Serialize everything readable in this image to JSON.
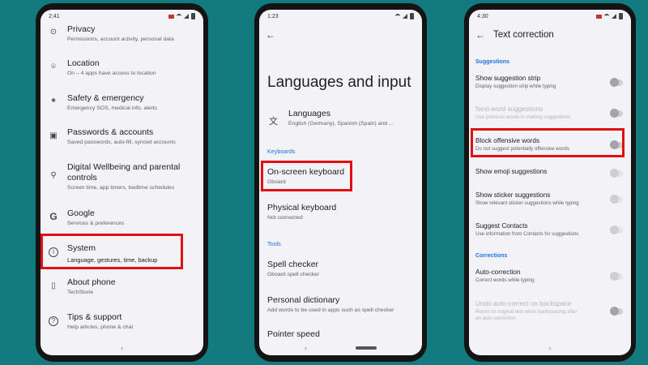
{
  "phone1": {
    "status": {
      "time": "2:41"
    },
    "items": [
      {
        "title": "Privacy",
        "subtitle": "Permissions, account activity, personal data",
        "icon": "privacy-icon"
      },
      {
        "title": "Location",
        "subtitle": "On – 4 apps have access to location",
        "icon": "location-pin-icon"
      },
      {
        "title": "Safety & emergency",
        "subtitle": "Emergency SOS, medical info, alerts",
        "icon": "asterisk-icon"
      },
      {
        "title": "Passwords & accounts",
        "subtitle": "Saved passwords, auto-fill, synced accounts",
        "icon": "person-card-icon"
      },
      {
        "title": "Digital Wellbeing and parental controls",
        "subtitle": "Screen time, app timers, bedtime schedules",
        "icon": "wellbeing-icon"
      },
      {
        "title": "Google",
        "subtitle": "Services & preferences",
        "icon": "google-icon"
      },
      {
        "title": "System",
        "subtitle": "Language, gestures, time, backup",
        "icon": "info-icon"
      },
      {
        "title": "About phone",
        "subtitle": "TechStone",
        "icon": "phone-icon"
      },
      {
        "title": "Tips & support",
        "subtitle": "Help articles, phone & chat",
        "icon": "help-icon"
      }
    ]
  },
  "phone2": {
    "status": {
      "time": "1:23"
    },
    "page_title": "Languages and input",
    "languages": {
      "title": "Languages",
      "subtitle": "English (Germany), Spanish (Spain) and ..."
    },
    "section_keyboards": "Keyboards",
    "onscreen": {
      "title": "On-screen keyboard",
      "subtitle": "Gboard"
    },
    "physical": {
      "title": "Physical keyboard",
      "subtitle": "Not connected"
    },
    "section_tools": "Tools",
    "spell": {
      "title": "Spell checker",
      "subtitle": "Gboard spell checker"
    },
    "dictionary": {
      "title": "Personal dictionary",
      "subtitle": "Add words to be used in apps such as spell checker"
    },
    "pointer": {
      "title": "Pointer speed"
    }
  },
  "phone3": {
    "status": {
      "time": "4:30"
    },
    "header_title": "Text correction",
    "section_suggestions": "Suggestions",
    "items": [
      {
        "title": "Show suggestion strip",
        "subtitle": "Display suggestion strip while typing",
        "enabled": true
      },
      {
        "title": "Next-word suggestions",
        "subtitle": "Use previous words in making suggestions",
        "enabled": false
      },
      {
        "title": "Block offensive words",
        "subtitle": "Do not suggest potentially offensive words",
        "enabled": true
      },
      {
        "title": "Show emoji suggestions",
        "subtitle": "",
        "enabled": true
      },
      {
        "title": "Show sticker suggestions",
        "subtitle": "Show relevant sticker suggestions while typing",
        "enabled": true
      },
      {
        "title": "Suggest Contacts",
        "subtitle": "Use information from Contacts for suggestions",
        "enabled": true
      }
    ],
    "section_corrections": "Corrections",
    "autocorrection": {
      "title": "Auto-correction",
      "subtitle": "Correct words while typing"
    },
    "undo": {
      "title": "Undo auto-correct on backspace",
      "subtitle1": "Return to original text when backspacing after",
      "subtitle2": "an auto-correction"
    }
  },
  "colors": {
    "background": "#137a7f",
    "highlight": "#e01111",
    "accent": "#1a73e8"
  }
}
